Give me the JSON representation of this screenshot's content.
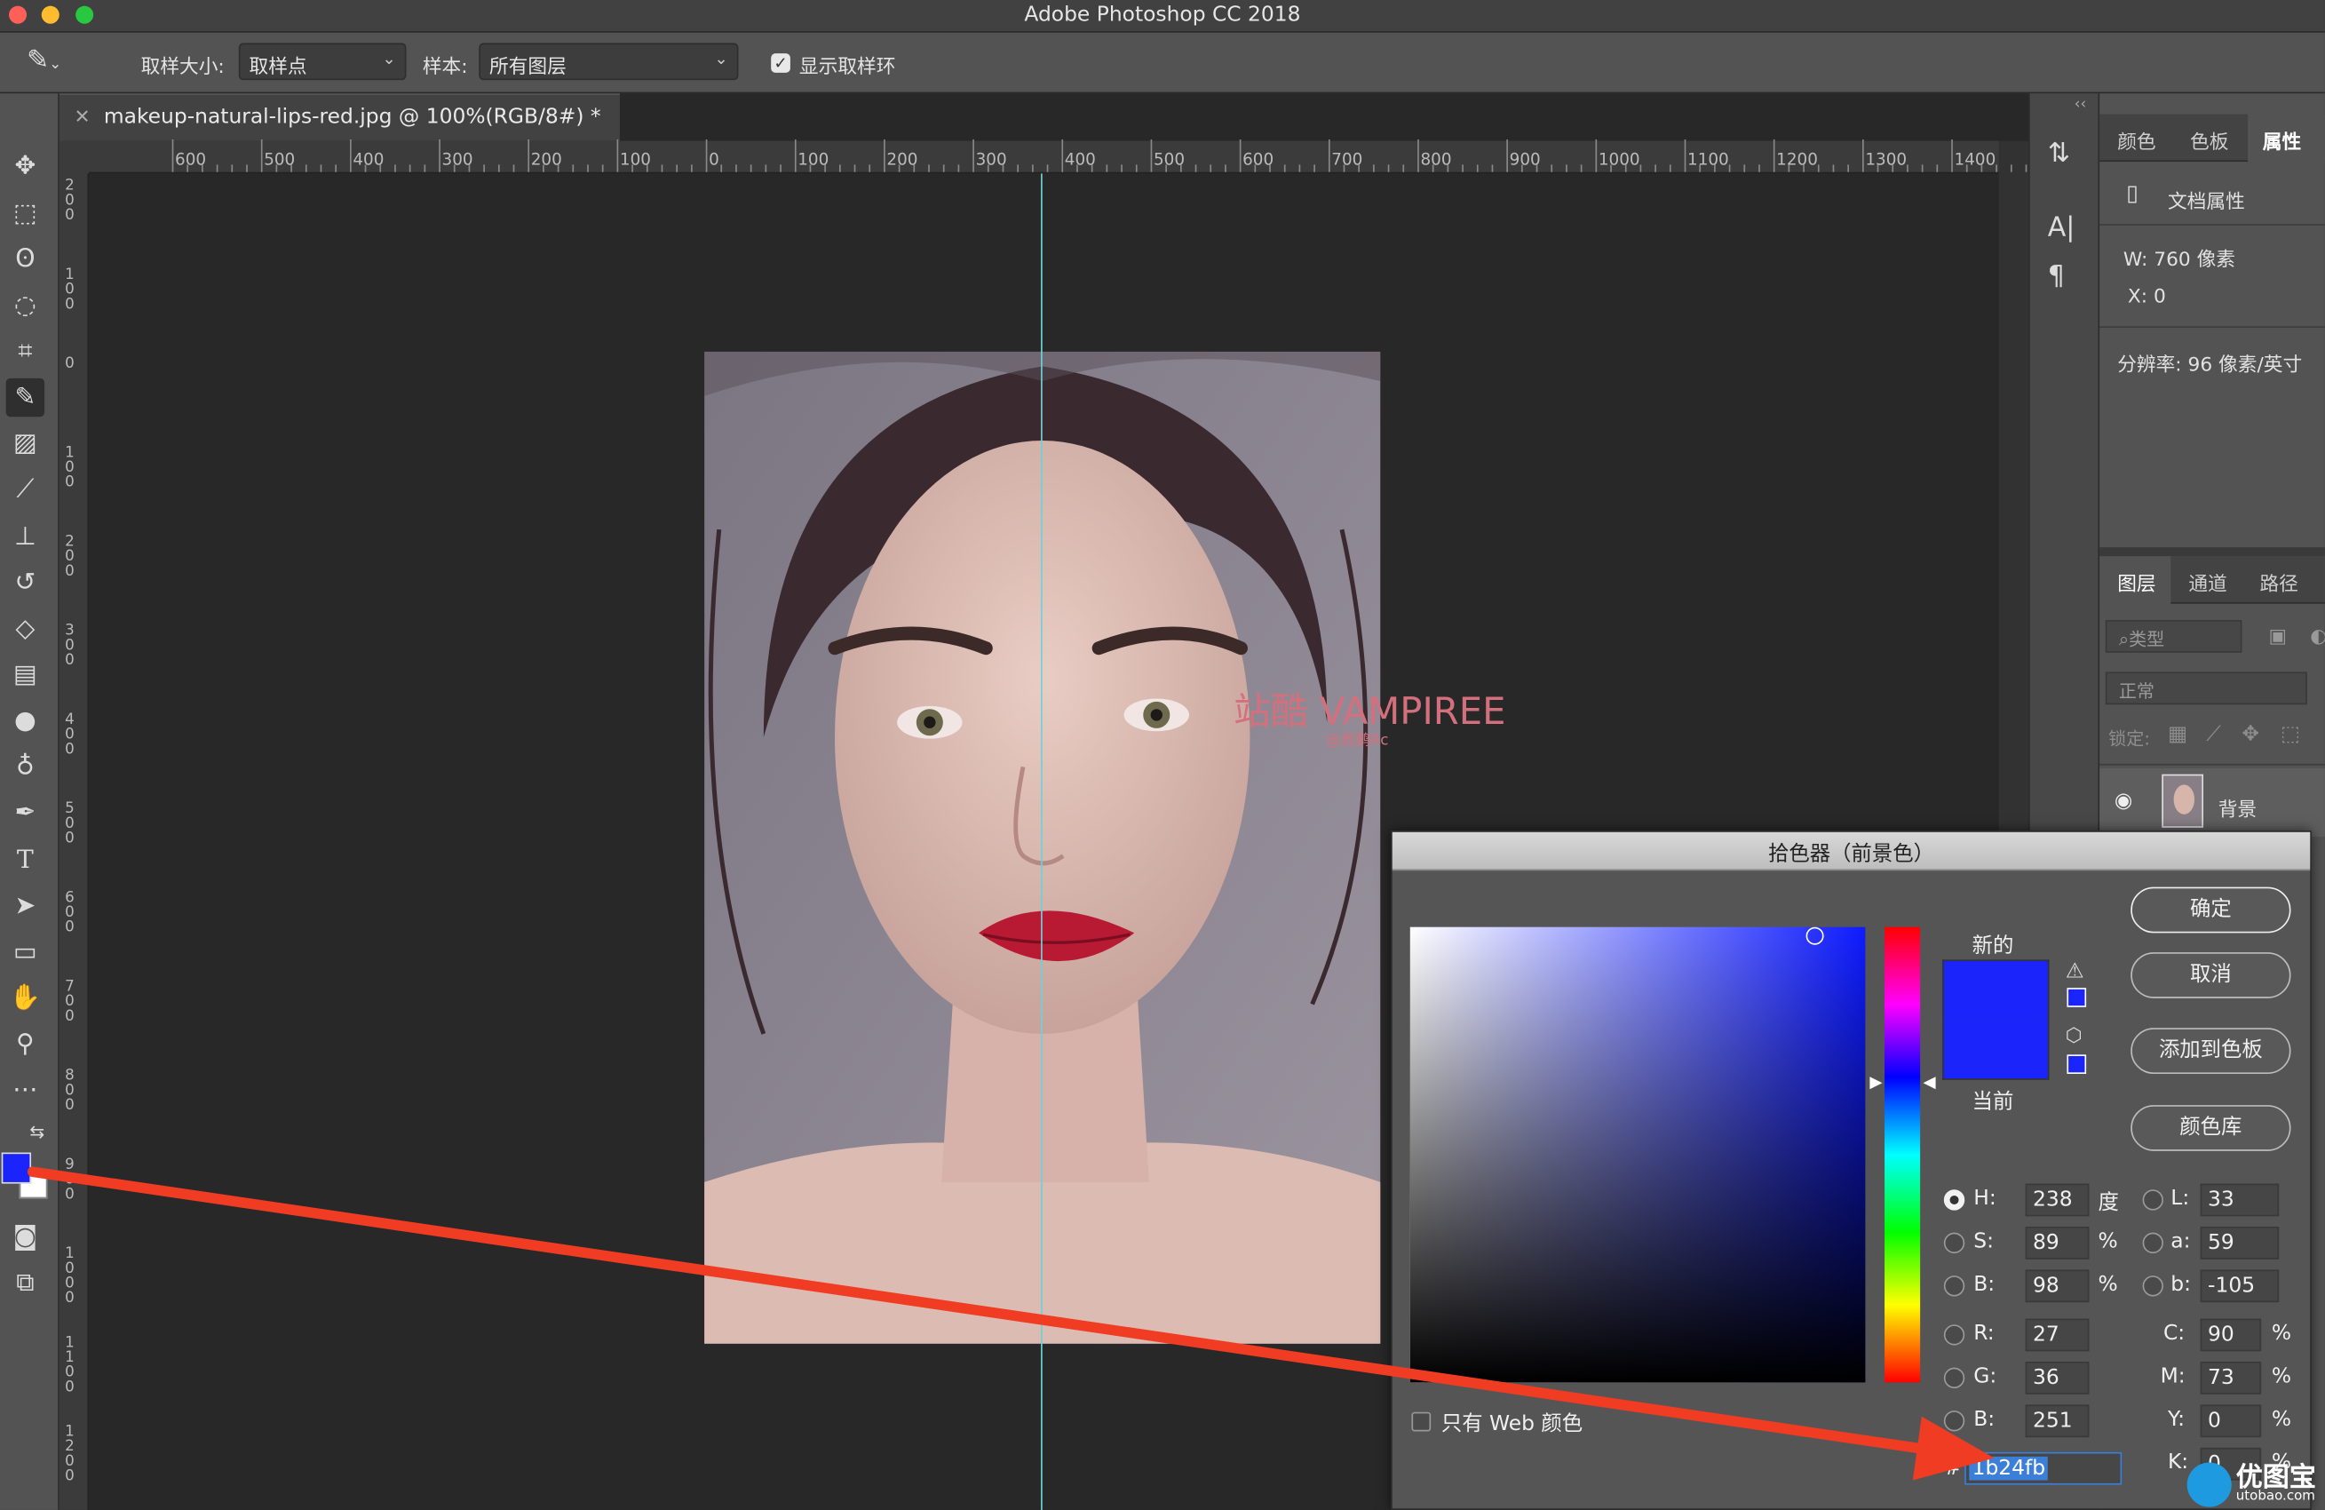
{
  "window": {
    "title": "Adobe Photoshop CC 2018"
  },
  "options": {
    "sample_size_label": "取样大小:",
    "sample_size_value": "取样点",
    "sample_label": "样本:",
    "sample_value": "所有图层",
    "show_ring_label": "显示取样环"
  },
  "document": {
    "tab_title": "makeup-natural-lips-red.jpg @ 100%(RGB/8#) *",
    "watermark_main": "站酷 VAMPIREE",
    "watermark_sub": "@周鹏Rc"
  },
  "ruler": {
    "h_labels": [
      "600",
      "500",
      "400",
      "300",
      "200",
      "100",
      "0",
      "100",
      "200",
      "300",
      "400",
      "500",
      "600",
      "700",
      "800",
      "900",
      "1000",
      "1100",
      "1200",
      "1300",
      "1400"
    ],
    "v_labels": [
      "200",
      "100",
      "0",
      "100",
      "200",
      "300",
      "400",
      "500",
      "600",
      "700",
      "800",
      "900",
      "1000",
      "1100",
      "1200"
    ]
  },
  "properties_panel": {
    "tabs": [
      "颜色",
      "色板",
      "属性"
    ],
    "doc_props_label": "文档属性",
    "width": "W: 760 像素",
    "x": "X: 0",
    "resolution": "分辨率: 96 像素/英寸"
  },
  "layers_panel": {
    "tabs": [
      "图层",
      "通道",
      "路径"
    ],
    "filter_placeholder": "类型",
    "blend_mode": "正常",
    "lock_label": "锁定:",
    "layer_name": "背景"
  },
  "color_picker": {
    "title": "拾色器（前景色）",
    "new_label": "新的",
    "current_label": "当前",
    "ok_button": "确定",
    "cancel_button": "取消",
    "add_swatch_button": "添加到色板",
    "color_library_button": "颜色库",
    "web_only_label": "只有 Web 颜色",
    "H": "238",
    "H_unit": "度",
    "S": "89",
    "S_unit": "%",
    "B_hsb": "98",
    "B_hsb_unit": "%",
    "R": "27",
    "G": "36",
    "B_rgb": "251",
    "L": "33",
    "a": "59",
    "b": "-105",
    "C": "90",
    "M": "73",
    "Y": "0",
    "K": "0",
    "C_unit": "%",
    "M_unit": "%",
    "Y_unit": "%",
    "K_unit": "%",
    "hex_label": "#",
    "hex": "1b24fb",
    "color_new": "#1b24fb",
    "color_current": "#1b24fb"
  },
  "footer_logo": {
    "text": "优图宝",
    "sub": "utobao.com"
  },
  "colors": {
    "foreground": "#1b24fb",
    "background": "#ffffff",
    "arrow": "#f03c22"
  }
}
